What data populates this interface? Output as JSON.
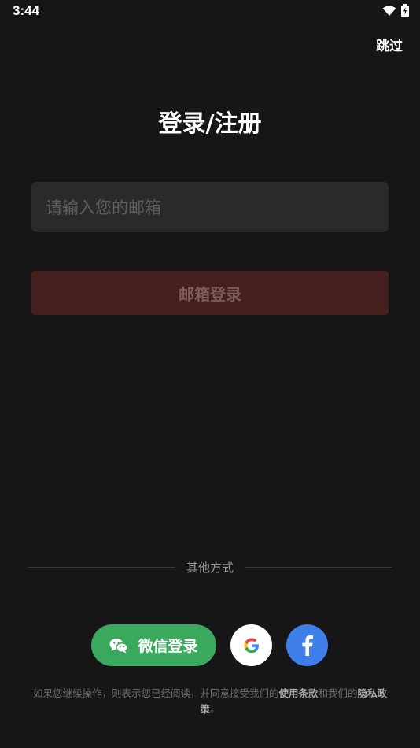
{
  "status_bar": {
    "time": "3:44"
  },
  "header": {
    "skip_label": "跳过"
  },
  "title": "登录/注册",
  "email_input": {
    "placeholder": "请输入您的邮箱",
    "value": ""
  },
  "email_login_button": "邮箱登录",
  "other_methods_label": "其他方式",
  "wechat_button": "微信登录",
  "terms": {
    "prefix": "如果您继续操作，则表示您已经阅读，并同意接受我们的",
    "terms_link": "使用条款",
    "middle": "和我们的",
    "privacy_link": "隐私政策",
    "suffix": "。"
  },
  "colors": {
    "background": "#161616",
    "wechat": "#3ba95d",
    "facebook": "#3f7fea",
    "login_button": "#451e1e"
  },
  "icons": [
    "wifi-icon",
    "battery-icon",
    "wechat-icon",
    "google-icon",
    "facebook-icon"
  ]
}
